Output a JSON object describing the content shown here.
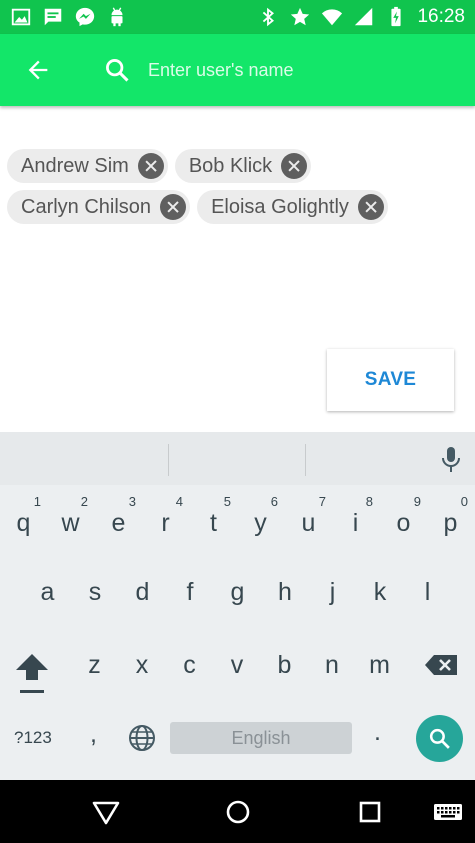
{
  "status_bar": {
    "time": "16:28",
    "left_icons": [
      "image-icon",
      "message-icon",
      "messenger-icon",
      "android-icon"
    ],
    "right_icons": [
      "bluetooth-icon",
      "star-icon",
      "wifi-icon",
      "signal-icon",
      "battery-charging-icon"
    ]
  },
  "app_bar": {
    "back_icon": "arrow-back-icon",
    "search_icon": "search-icon",
    "search_placeholder": "Enter user's name",
    "color": "#13e669"
  },
  "chips": [
    {
      "label": "Andrew Sim"
    },
    {
      "label": "Bob Klick"
    },
    {
      "label": "Carlyn Chilson"
    },
    {
      "label": "Eloisa Golightly"
    }
  ],
  "save_button": {
    "label": "SAVE",
    "color": "#1e88d6"
  },
  "keyboard": {
    "row1": [
      {
        "key": "q",
        "hint": "1"
      },
      {
        "key": "w",
        "hint": "2"
      },
      {
        "key": "e",
        "hint": "3"
      },
      {
        "key": "r",
        "hint": "4"
      },
      {
        "key": "t",
        "hint": "5"
      },
      {
        "key": "y",
        "hint": "6"
      },
      {
        "key": "u",
        "hint": "7"
      },
      {
        "key": "i",
        "hint": "8"
      },
      {
        "key": "o",
        "hint": "9"
      },
      {
        "key": "p",
        "hint": "0"
      }
    ],
    "row2": [
      "a",
      "s",
      "d",
      "f",
      "g",
      "h",
      "j",
      "k",
      "l"
    ],
    "row3": [
      "z",
      "x",
      "c",
      "v",
      "b",
      "n",
      "m"
    ],
    "symbols_label": "?123",
    "comma": ",",
    "space_label": "English",
    "period": ".",
    "action_color": "#26a69a"
  },
  "nav_bar": {
    "icons": [
      "back-triangle-icon",
      "home-circle-icon",
      "recents-square-icon",
      "keyboard-switch-icon"
    ]
  }
}
